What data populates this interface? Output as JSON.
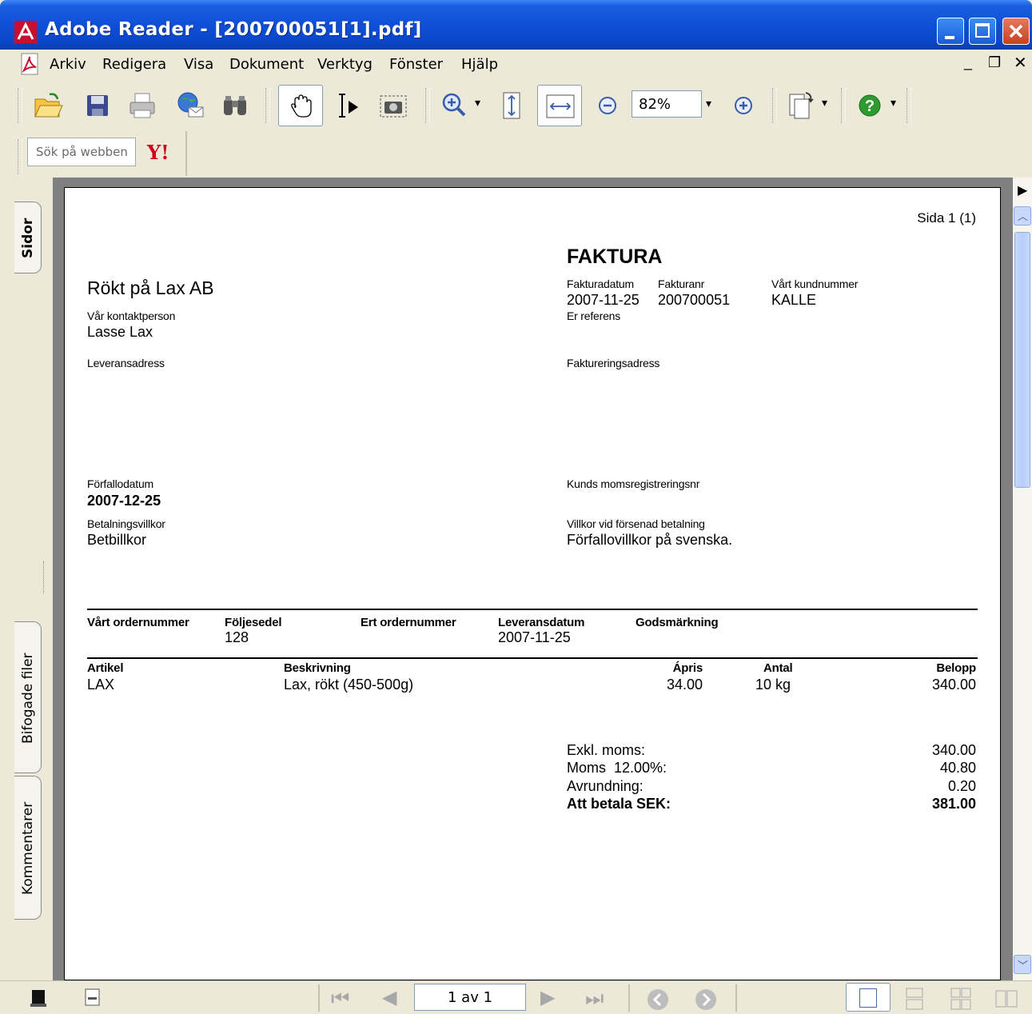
{
  "window": {
    "title": "Adobe Reader - [200700051[1].pdf]",
    "title_bar_color": "#0a46c8"
  },
  "menu": {
    "items": [
      "Arkiv",
      "Redigera",
      "Visa",
      "Dokument",
      "Verktyg",
      "Fönster",
      "Hjälp"
    ]
  },
  "toolbar": {
    "zoom_value": "82%",
    "search_placeholder": "Sök på webben",
    "yahoo_label": "Y!"
  },
  "nav_tabs": {
    "pages": "Sidor",
    "attachments": "Bifogade filer",
    "comments": "Kommentarer"
  },
  "status": {
    "page_indicator": "1 av 1"
  },
  "invoice": {
    "page_label": "Sida 1 (1)",
    "doc_title": "FAKTURA",
    "company": "Rökt på Lax AB",
    "contact_label": "Vår kontaktperson",
    "contact_value": "Lasse Lax",
    "invoice_date_label": "Fakturadatum",
    "invoice_date": "2007-11-25",
    "invoice_no_label": "Fakturanr",
    "invoice_no": "200700051",
    "customer_no_label": "Vårt kundnummer",
    "customer_no": "KALLE",
    "your_ref_label": "Er referens",
    "delivery_address_label": "Leveransadress",
    "billing_address_label": "Faktureringsadress",
    "due_date_label": "Förfallodatum",
    "due_date": "2007-12-25",
    "vat_reg_label": "Kunds momsregistreringsnr",
    "payment_terms_label": "Betalningsvillkor",
    "payment_terms": "Betbillkor",
    "late_terms_label": "Villkor vid försenad betalning",
    "late_terms": "Förfallovillkor på svenska.",
    "order_headers": {
      "our_order": "Vårt ordernummer",
      "delivery_note": "Följesedel",
      "your_order": "Ert ordernummer",
      "delivery_date": "Leveransdatum",
      "goods_marking": "Godsmärkning"
    },
    "order_values": {
      "delivery_note": "128",
      "delivery_date": "2007-11-25"
    },
    "item_headers": {
      "article": "Artikel",
      "description": "Beskrivning",
      "unit_price": "Ápris",
      "quantity": "Antal",
      "amount": "Belopp"
    },
    "items": [
      {
        "article": "LAX",
        "description": "Lax, rökt (450-500g)",
        "unit_price": "34.00",
        "quantity": "10 kg",
        "amount": "340.00"
      }
    ],
    "totals": {
      "excl_vat_label": "Exkl. moms:",
      "excl_vat": "340.00",
      "vat_label": "Moms  12.00%:",
      "vat": "40.80",
      "rounding_label": "Avrundning:",
      "rounding": "0.20",
      "to_pay_label": "Att betala SEK:",
      "to_pay": "381.00"
    }
  }
}
